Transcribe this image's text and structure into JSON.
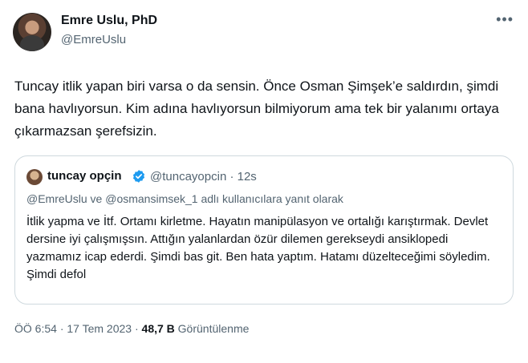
{
  "author": {
    "name": "Emre Uslu, PhD",
    "handle": "@EmreUslu",
    "avatar_icon": "profile-photo"
  },
  "more_icon": "more-dots-icon",
  "text": "Tuncay itlik yapan biri varsa o da sensin. Önce Osman Şimşek’e saldırdın, şimdi bana havlıyorsun. Kim adına havlıyorsun bilmiyorum ama tek bir yalanımı ortaya çıkarmazsan şerefsizin.",
  "quoted": {
    "name": "tuncay opçin",
    "verified_icon": "verified-badge-icon",
    "handle": "@tuncayopcin",
    "separator": "·",
    "time": "12s",
    "reply_context": "@EmreUslu ve @osmansimsek_1 adlı kullanıcılara yanıt olarak",
    "text": "İtlik yapma ve İtf. Ortamı kirletme. Hayatın manipülasyon ve ortalığı karıştırmak. Devlet dersine iyi çalışmışsın. Attığın yalanlardan özür dilemen gerekseydi ansiklopedi yazmamız icap ederdi. Şimdi bas git. Ben hata yaptım. Hatamı düzelteceğimi söyledim. Şimdi defol"
  },
  "meta": {
    "time": "ÖÖ 6:54",
    "separator": "·",
    "date": "17 Tem 2023",
    "views_count": "48,7 B",
    "views_label": "Görüntülenme"
  },
  "colors": {
    "text": "#0f1419",
    "secondary": "#536471",
    "border": "#cfd9de",
    "verified": "#1d9bf0"
  }
}
